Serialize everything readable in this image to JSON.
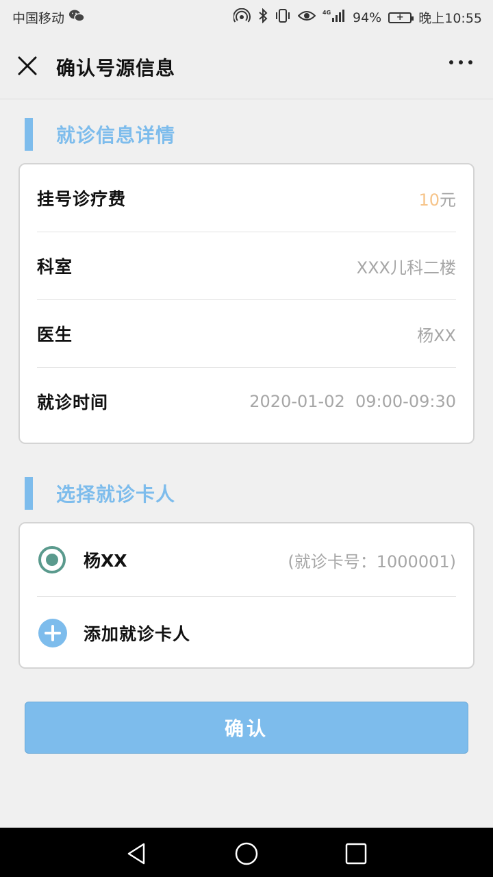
{
  "status_bar": {
    "carrier": "中国移动",
    "network": "4G",
    "battery": "94%",
    "time": "晚上10:55"
  },
  "header": {
    "title": "确认号源信息"
  },
  "visit_section": {
    "title": "就诊信息详情",
    "rows": [
      {
        "label": "挂号诊疗费"
      },
      {
        "label": "科室",
        "value": "XXX儿科二楼"
      },
      {
        "label": "医生",
        "value": "杨XX"
      },
      {
        "label": "就诊时间",
        "value": "2020-01-02  09:00-09:30"
      }
    ],
    "fee": {
      "amount": "10",
      "unit": "元"
    }
  },
  "patient_section": {
    "title": "选择就诊卡人",
    "selected_patient": {
      "name": "杨XX",
      "card": "(就诊卡号：1000001)"
    },
    "add_label": "添加就诊卡人"
  },
  "confirm_label": "确认",
  "colors": {
    "accent": "#7dbcec",
    "radio": "#5a9a8d",
    "fee": "#f6c48a"
  },
  "icons": [
    "close-icon",
    "more-icon",
    "radio-selected-icon",
    "add-icon",
    "nav-back-icon",
    "nav-home-icon",
    "nav-recent-icon"
  ]
}
